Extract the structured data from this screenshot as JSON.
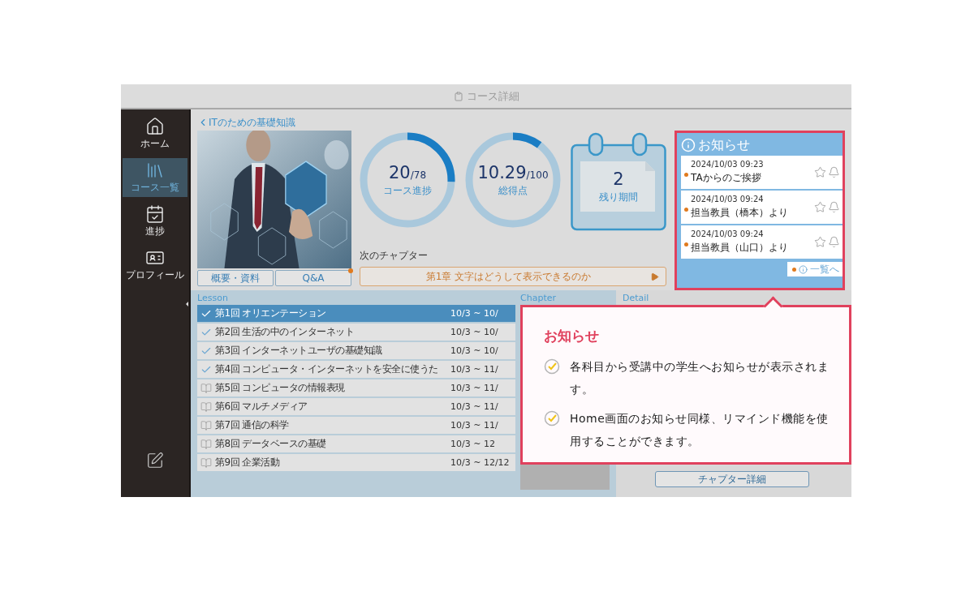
{
  "window": {
    "title": "コース詳細"
  },
  "sidebar": {
    "items": [
      {
        "kind": "home",
        "label": "ホーム",
        "selected": false
      },
      {
        "kind": "courses",
        "label": "コース一覧",
        "selected": true
      },
      {
        "kind": "progress",
        "label": "進捗",
        "selected": false
      },
      {
        "kind": "profile",
        "label": "プロフィール",
        "selected": false
      }
    ]
  },
  "course": {
    "title": "ITのための基礎知識",
    "buttons": [
      {
        "label": "概要・資料",
        "notification": false
      },
      {
        "label": "Q&A",
        "notification": true
      }
    ]
  },
  "metrics": [
    {
      "kind": "ring",
      "value": "20",
      "total": "/78",
      "label": "コース進捗",
      "level": 0.256
    },
    {
      "kind": "ring",
      "value": "10.29",
      "total": "/100",
      "label": "総得点",
      "level": 0.103
    },
    {
      "kind": "calendar",
      "value": "2",
      "label": "残り期間"
    }
  ],
  "next_chapter": {
    "label": "次のチャプター",
    "title": "第1章 文字はどうして表示できるのか"
  },
  "notices": {
    "title": "お知らせ",
    "items": [
      {
        "date": "2024/10/03 09:23",
        "title": "TAからのご挨拶",
        "unread": true
      },
      {
        "date": "2024/10/03 09:24",
        "title": "担当教員（橋本）より",
        "unread": true
      },
      {
        "date": "2024/10/03 09:24",
        "title": "担当教員（山口）より",
        "unread": true
      }
    ],
    "more_link": "一覧へ"
  },
  "lessons": {
    "columns": [
      "Lesson",
      "Chapter",
      "Detail"
    ],
    "rows": [
      {
        "title": "第1回 オリエンテーション",
        "period": "10/3 ~ 10/",
        "done": true,
        "selected": true
      },
      {
        "title": "第2回 生活の中のインターネット",
        "period": "10/3 ~ 10/",
        "done": true,
        "selected": false
      },
      {
        "title": "第3回 インターネットユーザの基礎知識",
        "period": "10/3 ~ 10/",
        "done": true,
        "selected": false
      },
      {
        "title": "第4回 コンピュータ・インターネットを安全に使うた",
        "period": "10/3 ~  11/",
        "done": true,
        "selected": false
      },
      {
        "title": "第5回 コンピュータの情報表現",
        "period": "10/3 ~ 11/",
        "done": false,
        "selected": false
      },
      {
        "title": "第6回 マルチメディア",
        "period": "10/3 ~ 11/",
        "done": false,
        "selected": false
      },
      {
        "title": "第7回 通信の科学",
        "period": "10/3 ~ 11/",
        "done": false,
        "selected": false
      },
      {
        "title": "第8回 データベースの基礎",
        "period": "10/3 ~  12",
        "done": false,
        "selected": false
      },
      {
        "title": "第9回 企業活動",
        "period": "10/3 ~ 12/12",
        "done": false,
        "selected": false
      }
    ]
  },
  "detail": {
    "button": "チャプター詳細"
  },
  "callout": {
    "title": "お知らせ",
    "points": [
      "各科目から受講中の学生へお知らせが表示されます。",
      "Home画面のお知らせ同様、リマインド機能を使用することができます。"
    ]
  }
}
